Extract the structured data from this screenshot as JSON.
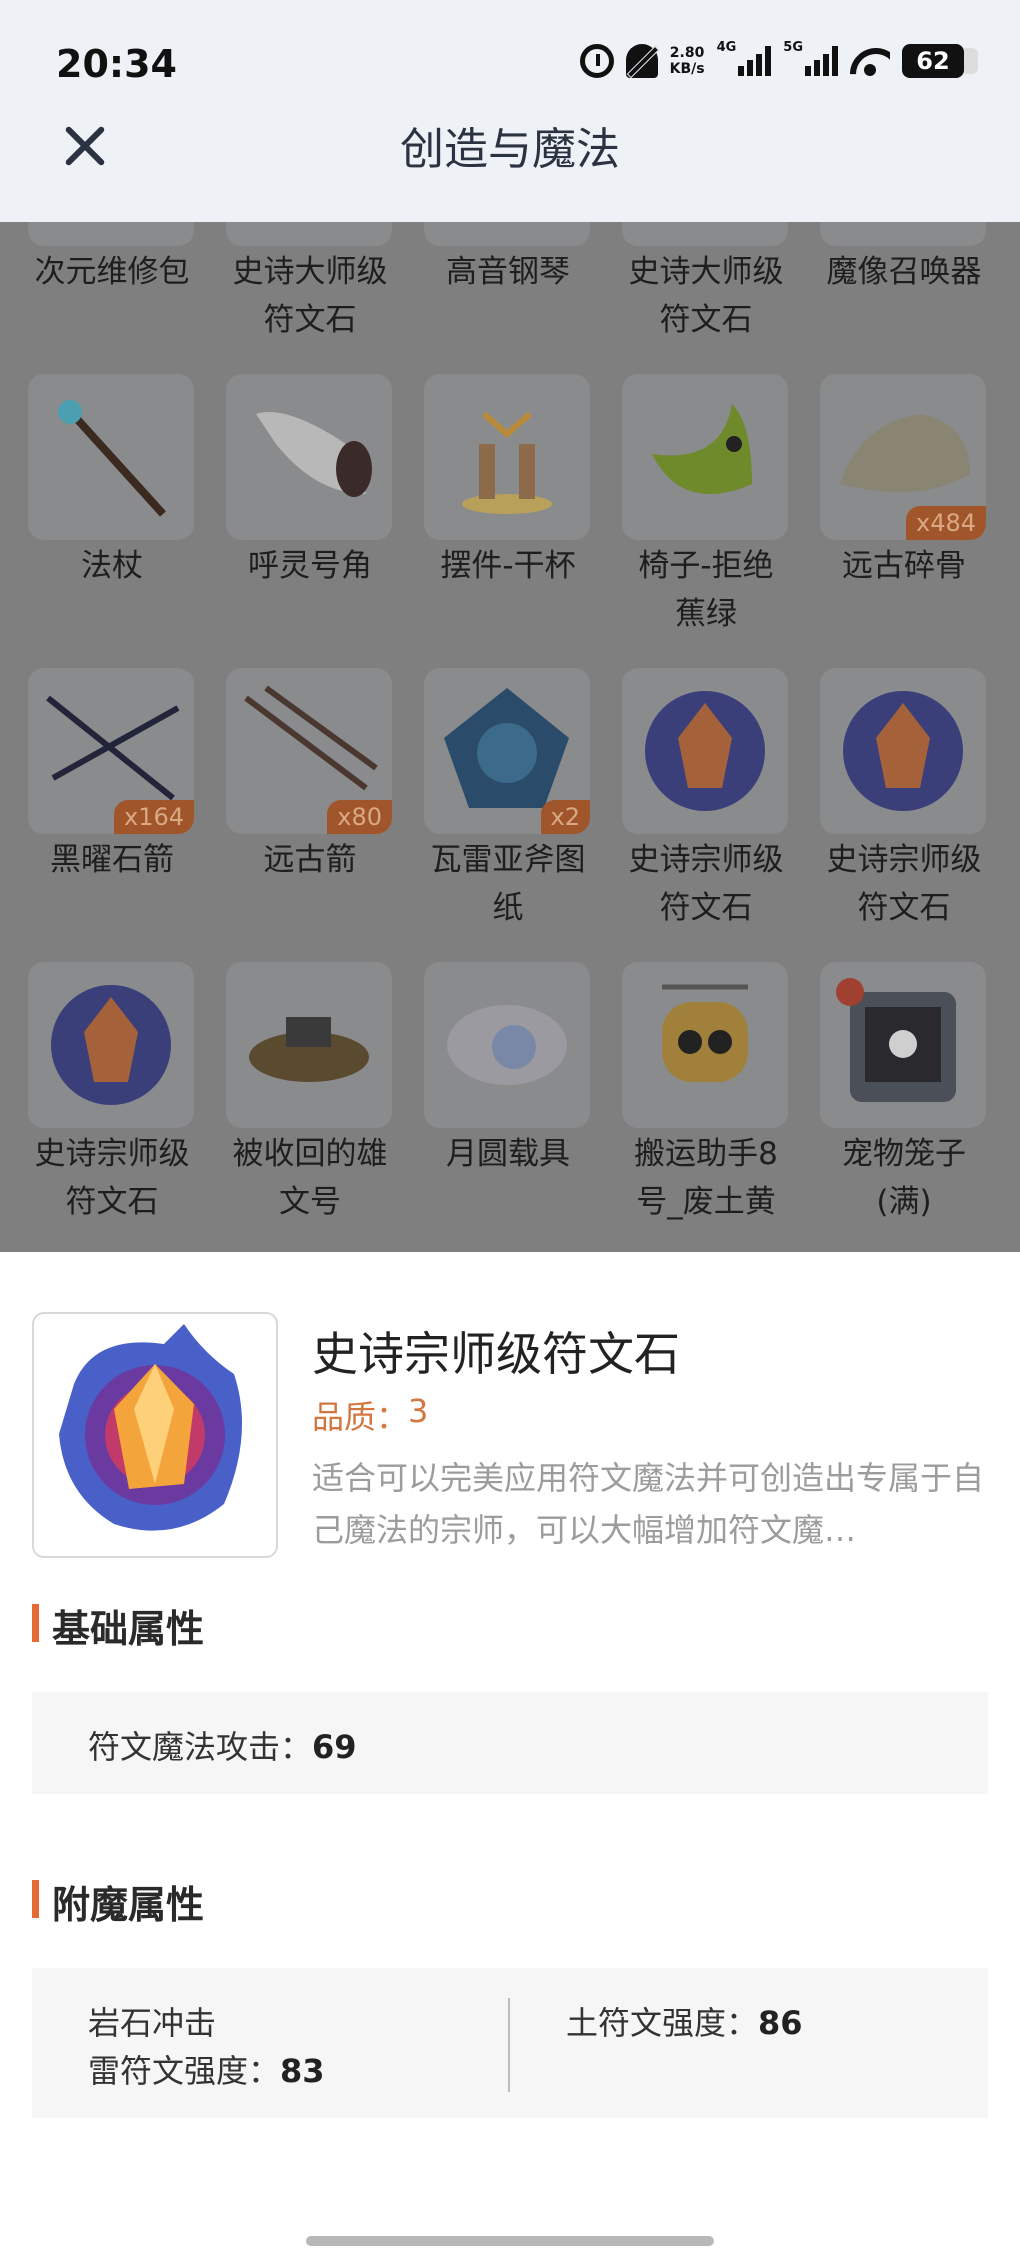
{
  "status_bar": {
    "time": "20:34",
    "net_speed_value": "2.80",
    "net_speed_unit": "KB/s",
    "signal_1": "4G",
    "signal_2": "5G",
    "battery": "62",
    "icons": [
      "alarm-icon",
      "mute-bell-icon",
      "wifi-icon",
      "battery-icon"
    ]
  },
  "header": {
    "title": "创造与魔法",
    "close_icon": "close-icon"
  },
  "grid": {
    "row0": [
      "次元维修包",
      "史诗大师级\n符文石",
      "高音钢琴",
      "史诗大师级\n符文石",
      "魔像召唤器"
    ],
    "row1": [
      {
        "label": "法杖",
        "badge": ""
      },
      {
        "label": "呼灵号角",
        "badge": ""
      },
      {
        "label": "摆件-干杯",
        "badge": ""
      },
      {
        "label": "椅子-拒绝\n蕉绿",
        "badge": ""
      },
      {
        "label": "远古碎骨",
        "badge": "x484"
      }
    ],
    "row2": [
      {
        "label": "黑曜石箭",
        "badge": "x164"
      },
      {
        "label": "远古箭",
        "badge": "x80"
      },
      {
        "label": "瓦雷亚斧图\n纸",
        "badge": "x2"
      },
      {
        "label": "史诗宗师级\n符文石",
        "badge": ""
      },
      {
        "label": "史诗宗师级\n符文石",
        "badge": ""
      }
    ],
    "row3": [
      {
        "label": "史诗宗师级\n符文石",
        "badge": ""
      },
      {
        "label": "被收回的雄\n文号",
        "badge": ""
      },
      {
        "label": "月圆载具",
        "badge": ""
      },
      {
        "label": "搬运助手8\n号_废土黄",
        "badge": ""
      },
      {
        "label": "宠物笼子\n(满)",
        "badge": ""
      }
    ]
  },
  "detail": {
    "name": "史诗宗师级符文石",
    "quality_label": "品质：",
    "quality_value": "3",
    "description": "适合可以完美应用符文魔法并可创造出专属于自己魔法的宗师，可以大幅增加符文魔…",
    "basic_title": "基础属性",
    "basic_attr_label": "符文魔法攻击：",
    "basic_attr_value": "69",
    "enchant_title": "附魔属性",
    "enchant_left_line1": "岩石冲击",
    "enchant_left_line2_label": "雷符文强度：",
    "enchant_left_line2_value": "83",
    "enchant_right_label": "土符文强度：",
    "enchant_right_value": "86"
  },
  "colors": {
    "accent": "#e36c35",
    "quality": "#d3763f",
    "header_bg": "#eef2f7",
    "overlay": "#7f7f80"
  }
}
